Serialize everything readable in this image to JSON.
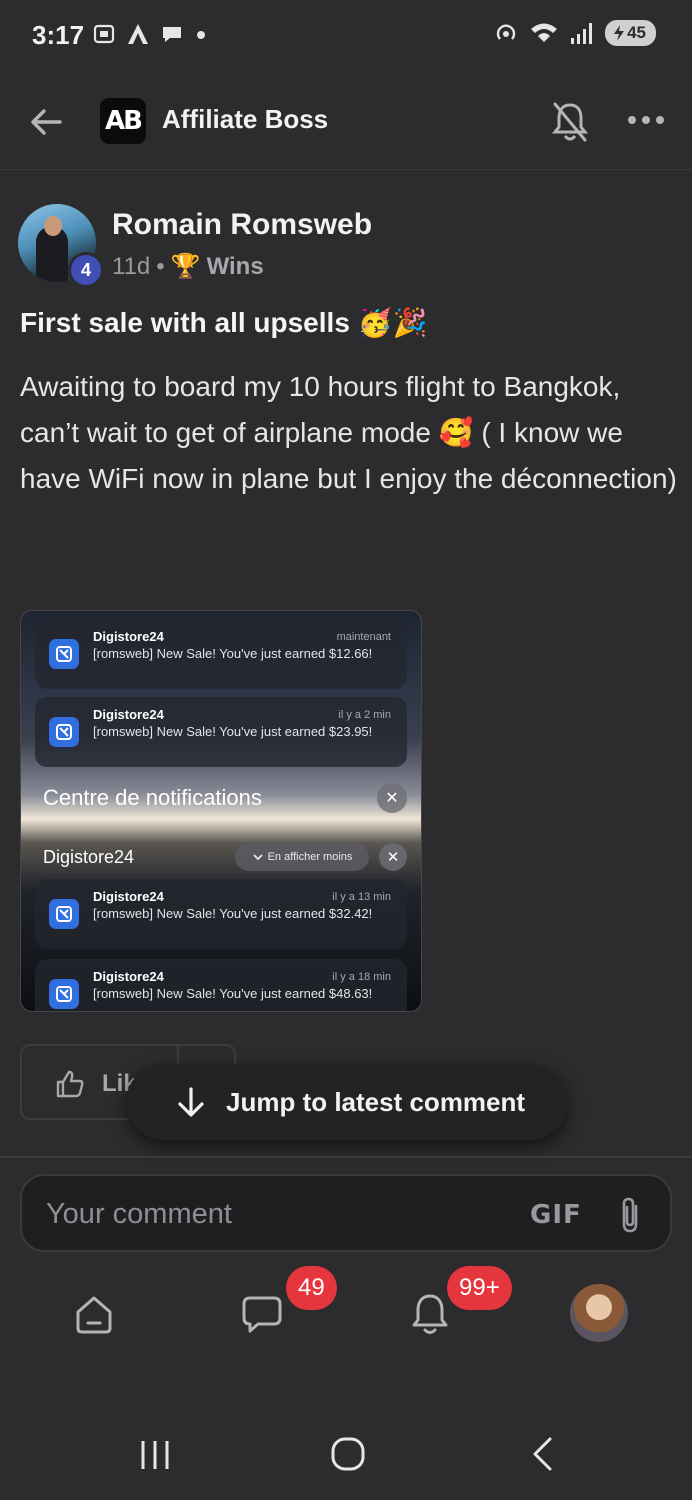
{
  "status_bar": {
    "time": "3:17",
    "battery": "45",
    "icons": [
      "screenshot-icon",
      "app-a-icon",
      "chat-bubble-icon",
      "dot-icon",
      "hotspot-icon",
      "wifi-icon",
      "signal-icon",
      "battery-icon"
    ]
  },
  "header": {
    "logo_text": "AB",
    "title": "Affiliate Boss"
  },
  "post": {
    "author": "Romain Romsweb",
    "level": "4",
    "age": "11d",
    "separator": "•",
    "category_emoji": "🏆",
    "category": "Wins",
    "title": "First sale with all upsells 🥳🎉",
    "body": "Awaiting to board my 10 hours flight to Bangkok, can’t wait to get of airplane mode 🥰 ( I know we have WiFi now in plane but I enjoy the déconnection)",
    "image": {
      "notifications_top": [
        {
          "app": "Digistore24",
          "time": "maintenant",
          "text": "[romsweb] New Sale! You've just earned $12.66!"
        },
        {
          "app": "Digistore24",
          "time": "il y a 2 min",
          "text": "[romsweb] New Sale! You've just earned $23.95!"
        }
      ],
      "center_title": "Centre de notifications",
      "group_title": "Digistore24",
      "show_less": "En afficher moins",
      "notifications_group": [
        {
          "app": "Digistore24",
          "time": "il y a 13 min",
          "text": "[romsweb] New Sale! You've just earned $32.42!"
        },
        {
          "app": "Digistore24",
          "time": "il y a 18 min",
          "text": "[romsweb] New Sale! You've just earned $48.63!"
        }
      ]
    }
  },
  "reactions": {
    "like_label": "Lik"
  },
  "jump": {
    "label": "Jump to latest comment"
  },
  "comment": {
    "placeholder": "Your comment",
    "gif_label": "GIF"
  },
  "bottom_nav": {
    "chat_badge": "49",
    "notifications_badge": "99+"
  },
  "colors": {
    "background": "#2c2c2e",
    "badge": "#e5363d",
    "level_badge": "#3f4fb5",
    "notification_icon": "#2f6fe0"
  }
}
